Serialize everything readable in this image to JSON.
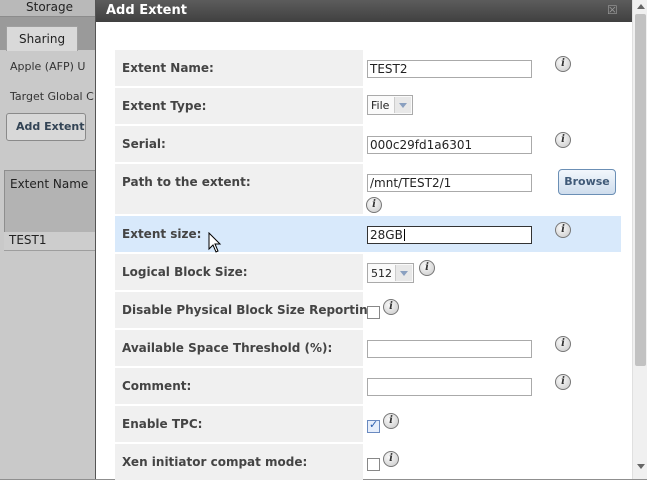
{
  "background": {
    "top_tab": "Storage",
    "sharing_tab": "Sharing",
    "afp_row": "Apple (AFP)  U",
    "target_row": "Target Global C",
    "add_extent_button": "Add Extent",
    "grid_header": "Extent Name",
    "grid_row": "TEST1"
  },
  "dialog": {
    "title": "Add Extent",
    "close_glyph": "☒",
    "info_glyph": "i",
    "fields": {
      "extent_name": {
        "label": "Extent Name:",
        "value": "TEST2"
      },
      "extent_type": {
        "label": "Extent Type:",
        "value": "File"
      },
      "serial": {
        "label": "Serial:",
        "value": "000c29fd1a6301"
      },
      "path": {
        "label": "Path to the extent:",
        "value": "/mnt/TEST2/1",
        "browse_label": "Browse"
      },
      "extent_size": {
        "label": "Extent size:",
        "value": "28GB"
      },
      "logical_block_size": {
        "label": "Logical Block Size:",
        "value": "512"
      },
      "disable_pbs": {
        "label": "Disable Physical Block Size Reporting:",
        "checked": false
      },
      "avail_threshold": {
        "label": "Available Space Threshold (%):",
        "value": ""
      },
      "comment": {
        "label": "Comment:",
        "value": ""
      },
      "enable_tpc": {
        "label": "Enable TPC:",
        "checked": true
      },
      "xen_compat": {
        "label": "Xen initiator compat mode:",
        "checked": false
      }
    }
  },
  "colors": {
    "titlebar": "#4a4a4a",
    "label_bg": "#f0f0f0",
    "highlight_row": "#d8e9fb",
    "browse_border": "#6b8fb5"
  }
}
